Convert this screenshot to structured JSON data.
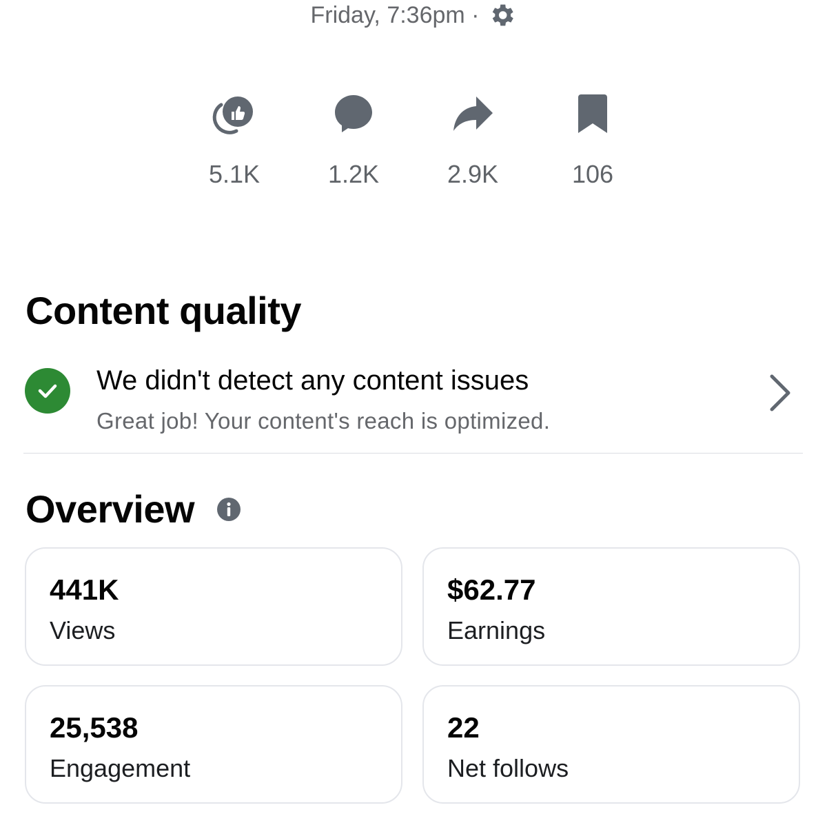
{
  "header": {
    "timestamp": "Friday, 7:36pm ·",
    "settings_icon": "gear-icon"
  },
  "stats": [
    {
      "icon": "reactions-icon",
      "value": "5.1K"
    },
    {
      "icon": "comment-icon",
      "value": "1.2K"
    },
    {
      "icon": "share-icon",
      "value": "2.9K"
    },
    {
      "icon": "bookmark-icon",
      "value": "106"
    }
  ],
  "content_quality": {
    "title": "Content quality",
    "status_icon": "check-circle-icon",
    "status_title": "We didn't detect any content issues",
    "status_subtitle": "Great job! Your content's reach is optimized.",
    "chevron_icon": "chevron-right-icon"
  },
  "overview": {
    "title": "Overview",
    "info_icon": "info-icon",
    "cards": [
      {
        "value": "441K",
        "label": "Views"
      },
      {
        "value": "$62.77",
        "label": "Earnings"
      },
      {
        "value": "25,538",
        "label": "Engagement"
      },
      {
        "value": "22",
        "label": "Net follows"
      }
    ]
  },
  "colors": {
    "success_green": "#2d8a34",
    "icon_gray": "#606770",
    "secondary_text": "#65676b",
    "card_border": "#e4e6eb"
  }
}
